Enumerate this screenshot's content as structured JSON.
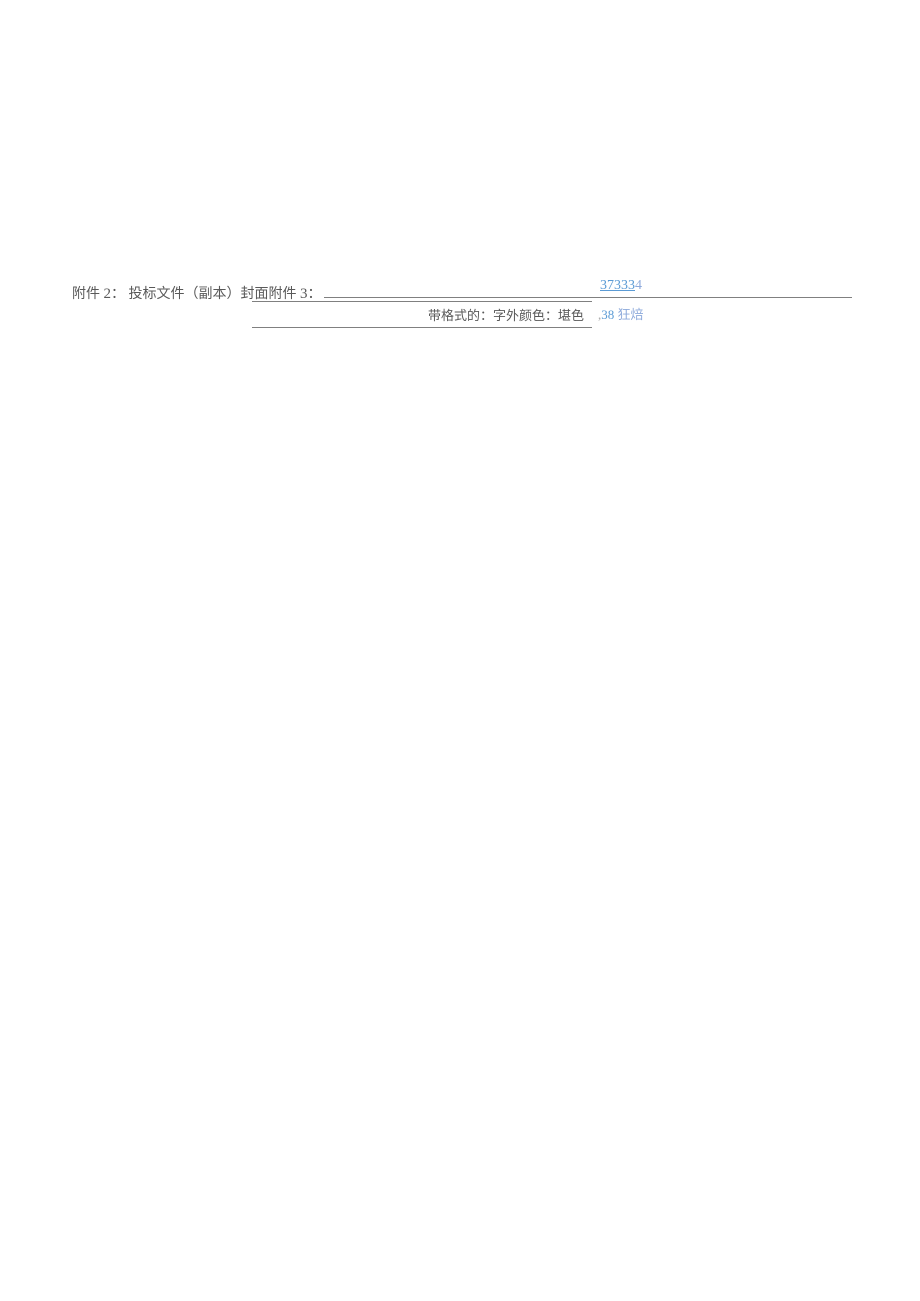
{
  "main": {
    "attachment_prefix_1": "附件 ",
    "attachment_num_1": "2",
    "attachment_suffix_1": "：",
    "attachment_text": " 投标文件（副本）封面附件 ",
    "attachment_num_2": "3",
    "attachment_suffix_2": "："
  },
  "right_number": {
    "underlined_part": "37333",
    "last_digit": "4"
  },
  "format_note": "带格式的：字外颜色：堪色",
  "annotation": {
    "comma": ",",
    "number": "38",
    "text": " 狂焙"
  }
}
